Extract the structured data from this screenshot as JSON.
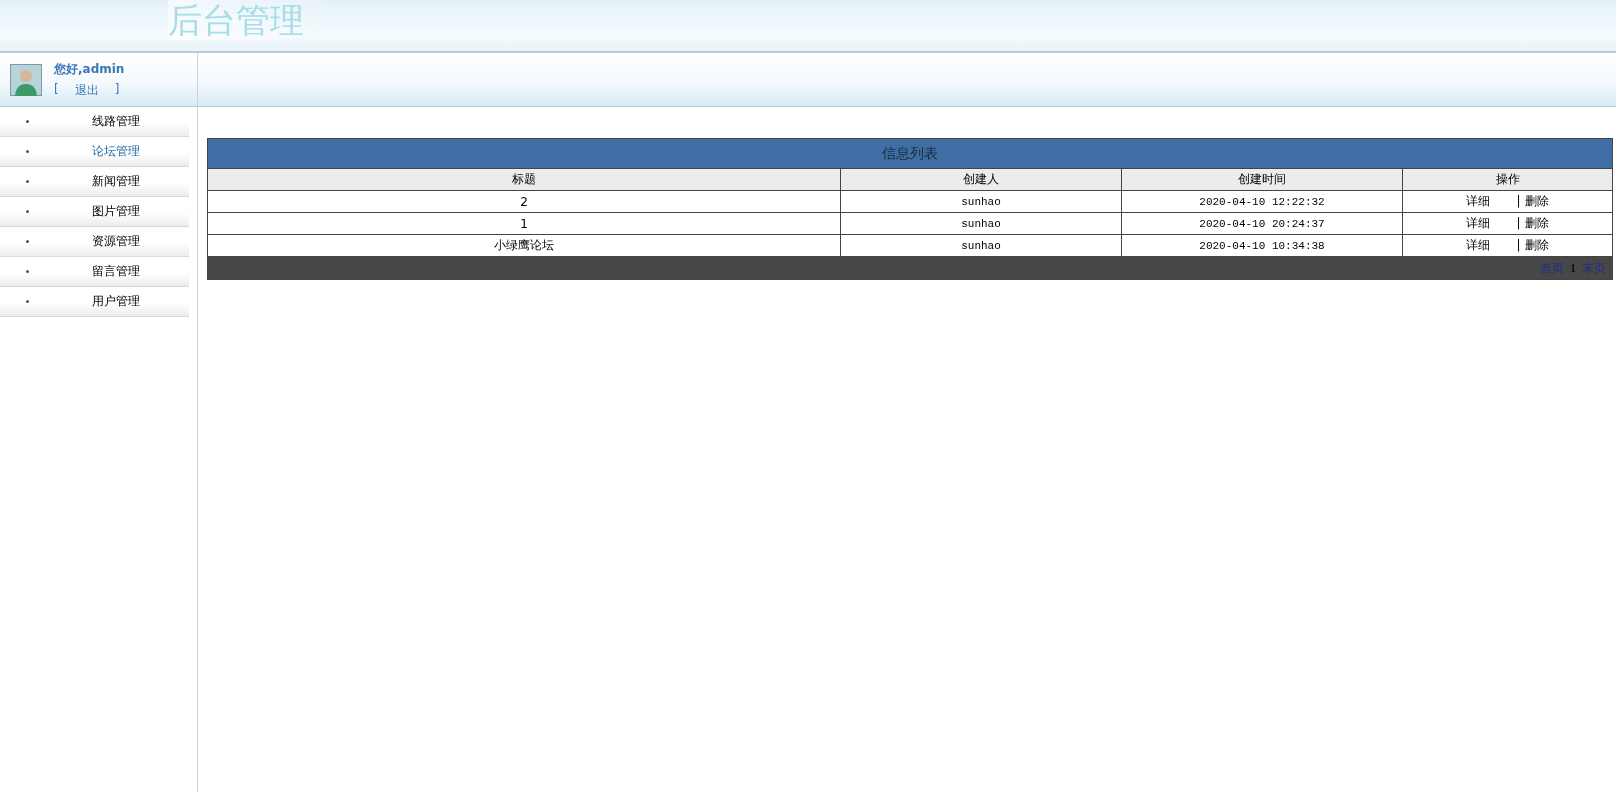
{
  "header": {
    "title": "后台管理"
  },
  "user": {
    "greeting": "您好,admin",
    "logout_open": "[",
    "logout": "退出",
    "logout_close": "]"
  },
  "menu": [
    {
      "label": "线路管理",
      "selected": false
    },
    {
      "label": "论坛管理",
      "selected": true
    },
    {
      "label": "新闻管理",
      "selected": false
    },
    {
      "label": "图片管理",
      "selected": false
    },
    {
      "label": "资源管理",
      "selected": false
    },
    {
      "label": "留言管理",
      "selected": false
    },
    {
      "label": "用户管理",
      "selected": false
    }
  ],
  "table": {
    "title": "信息列表",
    "columns": [
      "标题",
      "创建人",
      "创建时间",
      "操作"
    ],
    "rows": [
      {
        "title": "2",
        "creator": "sunhao",
        "created": "2020-04-10 12:22:32",
        "detail": "详细",
        "separator": "|",
        "delete": "删除"
      },
      {
        "title": "1",
        "creator": "sunhao",
        "created": "2020-04-10 20:24:37",
        "detail": "详细",
        "separator": "|",
        "delete": "删除"
      },
      {
        "title": "小绿鹰论坛",
        "creator": "sunhao",
        "created": "2020-04-10 10:34:38",
        "detail": "详细",
        "separator": "|",
        "delete": "删除"
      }
    ],
    "pagination": {
      "first": "首页",
      "current": "1",
      "last": "末页"
    }
  }
}
